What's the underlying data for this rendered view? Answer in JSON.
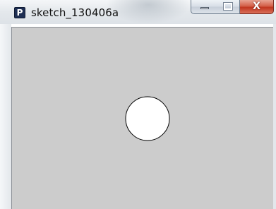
{
  "window": {
    "title": "sketch_130406a",
    "app_icon_letter": "P",
    "icon": "processing-app-icon",
    "controls": {
      "minimize_icon": "minimize-icon",
      "maximize_icon": "maximize-icon",
      "close_glyph": "X"
    }
  },
  "canvas": {
    "background_color": "#cccccc",
    "shape": {
      "type": "circle",
      "fill": "#ffffff",
      "stroke": "#000000"
    }
  }
}
